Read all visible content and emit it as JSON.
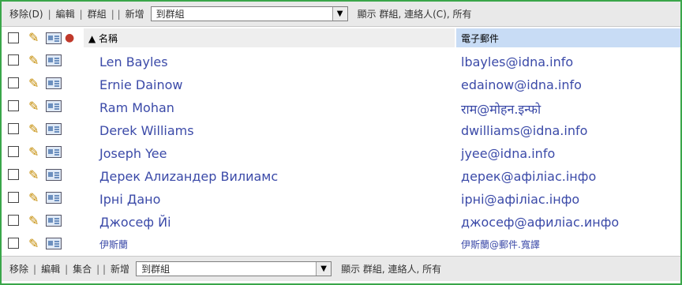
{
  "toolbar_top": {
    "move_label": "移除(D)",
    "edit_label": "編輯",
    "separator1": "|",
    "separator2": "|",
    "separator3": "| |",
    "group_label": "群組",
    "new_label": "新增",
    "filter_value": "到群組",
    "show_text": "顯示 群組, 連絡人(C), 所有"
  },
  "header": {
    "name_col": "▲ 名稱",
    "email_col": "電子郵件"
  },
  "contacts": [
    {
      "name": "Len Bayles",
      "email": "lbayles@idna.info"
    },
    {
      "name": "Ernie Dainow",
      "email": "edainow@idna.info"
    },
    {
      "name": "Ram Mohan",
      "email": "राम@मोहन.इन्फो"
    },
    {
      "name": "Derek Williams",
      "email": "dwilliams@idna.info"
    },
    {
      "name": "Joseph Yee",
      "email": "jyee@idna.info"
    },
    {
      "name": "Дерек Алиzандер Вилиамс",
      "email": "дерек@афіліас.інфо"
    },
    {
      "name": "Ірні Дано",
      "email": "ірні@афіліас.інфо"
    },
    {
      "name": "Джосеф Йі",
      "email": "джосеф@афиліас.инфо"
    },
    {
      "name": "伊斯蘭",
      "email": "伊斯蘭@郵件.寬譯"
    }
  ],
  "toolbar_bottom": {
    "move_label": "移除",
    "edit_label": "編輯",
    "group_label": "集合",
    "new_label": "新增",
    "filter_value": "到群組",
    "show_text": "顯示 群組, 連絡人, 所有"
  },
  "icons": {
    "checkbox": "checkbox",
    "pencil": "pencil-icon",
    "card": "contact-card-icon",
    "group": "group-icon",
    "dropdown": "chevron-down-icon"
  },
  "colors": {
    "frame_border": "#3aa64a",
    "link": "#3b4aa8",
    "email_header_bg": "#c8dcf5"
  }
}
